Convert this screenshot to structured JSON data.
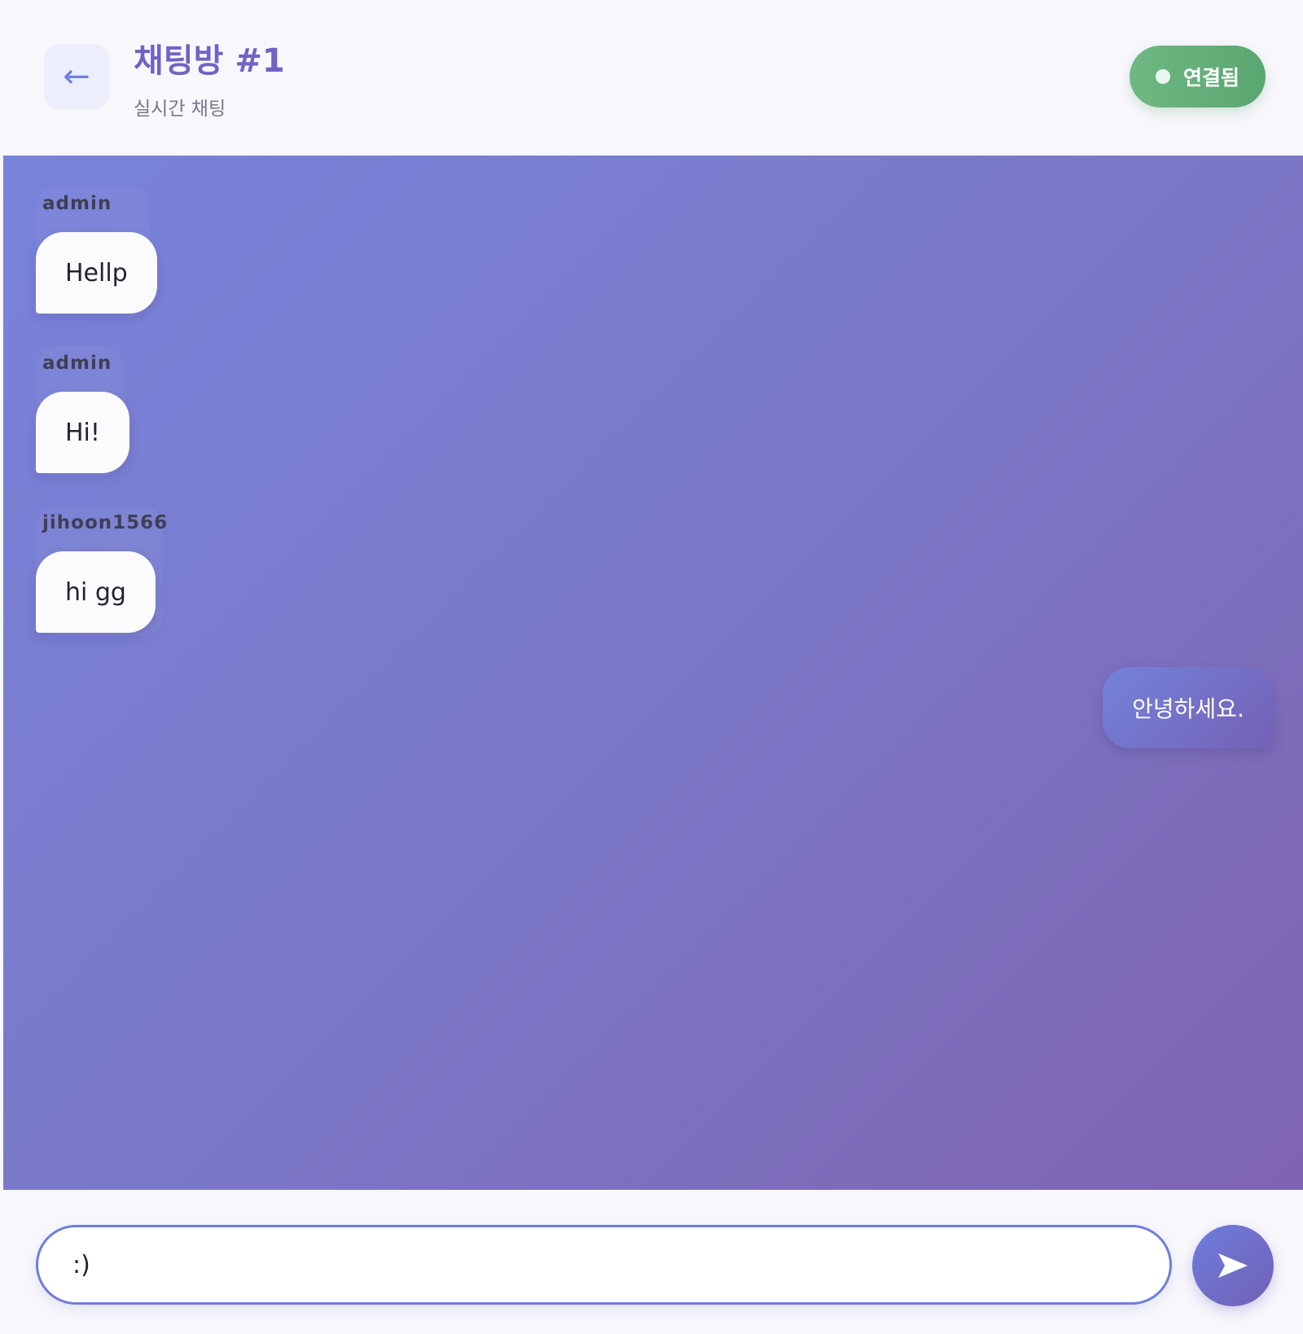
{
  "header": {
    "back_icon": "←",
    "title": "채팅방 #1",
    "subtitle": "실시간 채팅",
    "status": "연결됨",
    "status_color": "#5fae78"
  },
  "messages": [
    {
      "sender": "admin",
      "text": "Hellp",
      "mine": false
    },
    {
      "sender": "admin",
      "text": "Hi!",
      "mine": false
    },
    {
      "sender": "jihoon1566",
      "text": "hi gg",
      "mine": false
    },
    {
      "sender": "",
      "text": "안녕하세요.",
      "mine": true
    }
  ],
  "composer": {
    "value": ":)",
    "send_icon": "send-icon"
  },
  "colors": {
    "accent": "#6e7ddc",
    "accent_dark": "#7160b5",
    "title": "#7262c6"
  }
}
